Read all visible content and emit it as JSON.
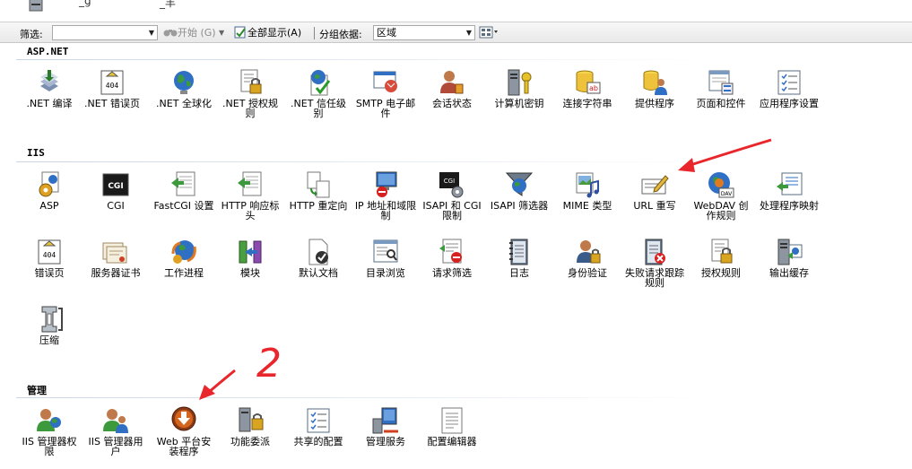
{
  "toolbar": {
    "filter_label": "筛选:",
    "start_label": "开始 (G)",
    "show_all_label": "全部显示(A)",
    "group_label": "分组依据:",
    "group_value": "区域"
  },
  "sections": {
    "aspnet": {
      "title": "ASP.NET",
      "items": [
        ".NET 编译",
        ".NET 错误页",
        ".NET 全球化",
        ".NET 授权规则",
        ".NET 信任级别",
        "SMTP 电子邮件",
        "会话状态",
        "计算机密钥",
        "连接字符串",
        "提供程序",
        "页面和控件",
        "应用程序设置"
      ]
    },
    "iis": {
      "title": "IIS",
      "items": [
        "ASP",
        "CGI",
        "FastCGI 设置",
        "HTTP 响应标头",
        "HTTP 重定向",
        "IP 地址和域限制",
        "ISAPI 和 CGI 限制",
        "ISAPI 筛选器",
        "MIME 类型",
        "URL 重写",
        "WebDAV 创作规则",
        "处理程序映射",
        "错误页",
        "服务器证书",
        "工作进程",
        "模块",
        "默认文档",
        "目录浏览",
        "请求筛选",
        "日志",
        "身份验证",
        "失败请求跟踪规则",
        "授权规则",
        "输出缓存",
        "压缩"
      ]
    },
    "management": {
      "title": "管理",
      "items": [
        "IIS 管理器权限",
        "IIS 管理器用户",
        "Web 平台安装程序",
        "功能委派",
        "共享的配置",
        "管理服务",
        "配置编辑器"
      ]
    }
  },
  "annotation": {
    "number": "2"
  },
  "colors": {
    "arrow_red": "#e8262b",
    "toolbar_bg": "#efefef",
    "section_line": "#c9d6e6"
  }
}
